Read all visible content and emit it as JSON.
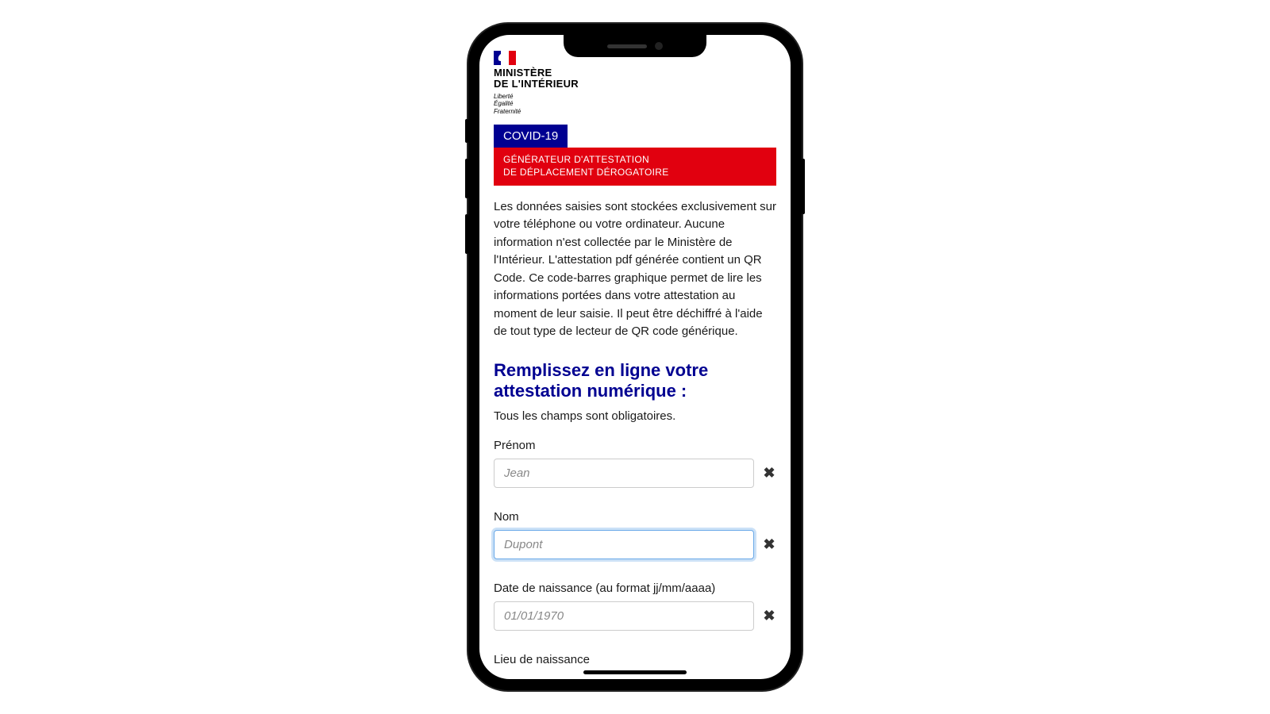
{
  "logo": {
    "ministry_line1": "MINISTÈRE",
    "ministry_line2": "DE L'INTÉRIEUR",
    "motto_line1": "Liberté",
    "motto_line2": "Égalité",
    "motto_line3": "Fraternité"
  },
  "badges": {
    "covid": "COVID-19",
    "red_line1": "GÉNÉRATEUR D'ATTESTATION",
    "red_line2": "DE DÉPLACEMENT DÉROGATOIRE"
  },
  "intro": "Les données saisies sont stockées exclusivement sur votre téléphone ou votre ordinateur. Aucune information n'est collectée par le Ministère de l'Intérieur. L'attestation pdf générée contient un QR Code. Ce code-barres graphique permet de lire les informations portées dans votre attestation au moment de leur saisie. Il peut être déchiffré à l'aide de tout type de lecteur de QR code générique.",
  "form": {
    "title": "Remplissez en ligne votre attestation numérique :",
    "subtitle": "Tous les champs sont obligatoires.",
    "fields": {
      "firstname": {
        "label": "Prénom",
        "placeholder": "Jean",
        "value": ""
      },
      "lastname": {
        "label": "Nom",
        "placeholder": "Dupont",
        "value": ""
      },
      "birthdate": {
        "label": "Date de naissance (au format jj/mm/aaaa)",
        "placeholder": "01/01/1970",
        "value": ""
      },
      "birthplace": {
        "label": "Lieu de naissance"
      }
    },
    "clear_icon": "✖"
  }
}
